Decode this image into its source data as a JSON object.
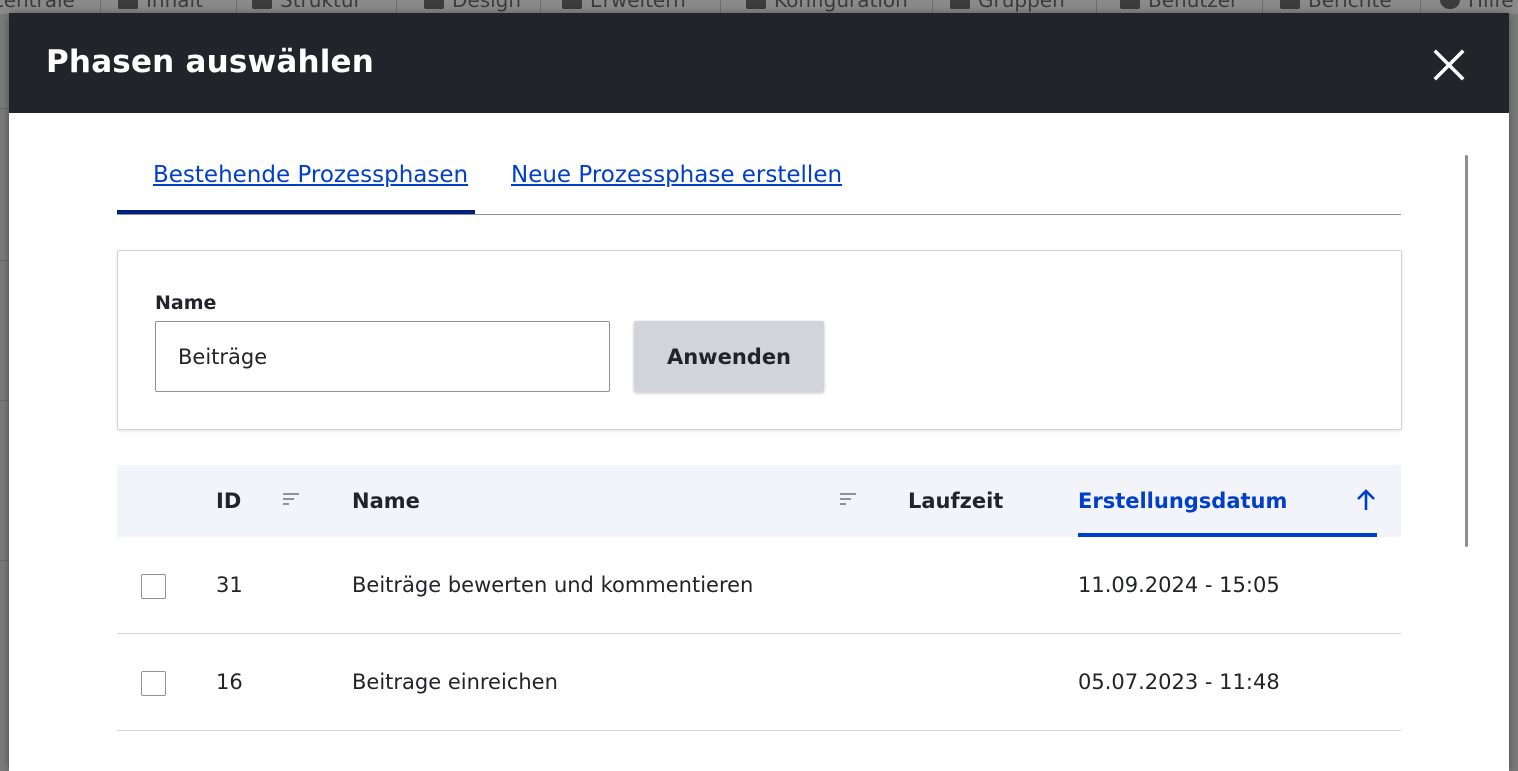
{
  "background": {
    "toolbar_items": [
      "Zentrale",
      "Inhalt",
      "Struktur",
      "Design",
      "Erweitern",
      "Konfiguration",
      "Gruppen",
      "Benutzer",
      "Berichte",
      "Hilfe"
    ]
  },
  "dialog": {
    "title": "Phasen auswählen",
    "close_label": "Schließen"
  },
  "tabs": [
    {
      "label": "Bestehende Prozessphasen",
      "active": true
    },
    {
      "label": "Neue Prozessphase erstellen",
      "active": false
    }
  ],
  "filter": {
    "label": "Name",
    "value": "Beiträge",
    "apply_label": "Anwenden"
  },
  "table": {
    "headers": {
      "id": "ID",
      "name": "Name",
      "laufzeit": "Laufzeit",
      "created": "Erstellungsdatum"
    },
    "sort": {
      "column": "created",
      "direction": "ascending"
    },
    "rows": [
      {
        "id": "31",
        "name": "Beiträge bewerten und kommentieren",
        "laufzeit": "",
        "created": "11.09.2024 - 15:05"
      },
      {
        "id": "16",
        "name": "Beitrage einreichen",
        "laufzeit": "",
        "created": "05.07.2023 - 11:48"
      }
    ]
  },
  "colors": {
    "header_bg": "#232429",
    "link": "#003ecc",
    "active_tab": "#00207f",
    "table_header_bg": "#f3f4f9",
    "button_bg": "#d3d4d9"
  }
}
